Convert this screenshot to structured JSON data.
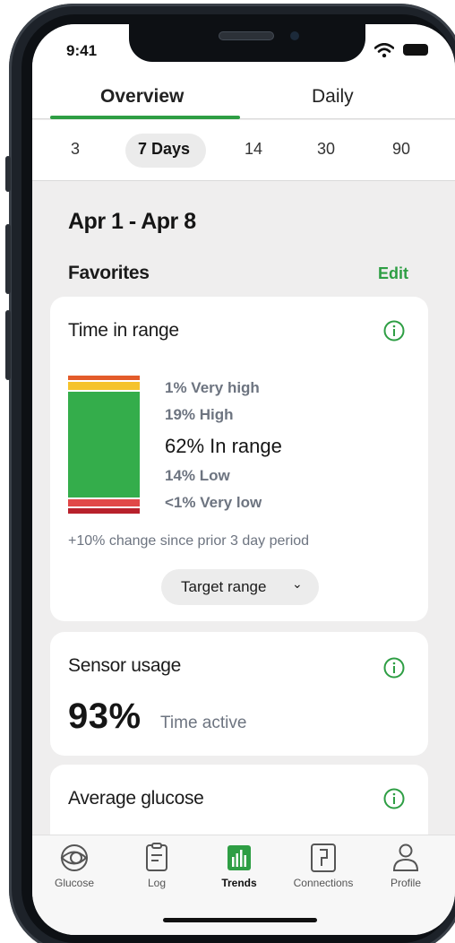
{
  "status_bar": {
    "time": "9:41"
  },
  "top_tabs": [
    {
      "label": "Overview",
      "active": true
    },
    {
      "label": "Daily",
      "active": false
    }
  ],
  "range_options": [
    {
      "label": "3",
      "selected": false
    },
    {
      "label": "7 Days",
      "selected": true
    },
    {
      "label": "14",
      "selected": false
    },
    {
      "label": "30",
      "selected": false
    },
    {
      "label": "90",
      "selected": false
    }
  ],
  "date_range": "Apr 1 - Apr 8",
  "favorites": {
    "title": "Favorites",
    "edit_label": "Edit"
  },
  "time_in_range": {
    "title": "Time in range",
    "very_high": "1% Very high",
    "high": "19% High",
    "in_range": "62% In range",
    "low": "14% Low",
    "very_low": "<1% Very low",
    "change_text": "+10% change since prior 3 day period",
    "target_button": "Target range",
    "colors": {
      "very_high": "#e35b2a",
      "high": "#f5c32c",
      "in_range": "#34ad4b",
      "low": "#e14848",
      "very_low": "#b8212c"
    }
  },
  "sensor_usage": {
    "title": "Sensor usage",
    "value": "93%",
    "unit": "Time active"
  },
  "average_glucose": {
    "title": "Average glucose"
  },
  "bottom_nav": [
    {
      "label": "Glucose",
      "icon": "sensor-icon",
      "active": false
    },
    {
      "label": "Log",
      "icon": "clipboard-icon",
      "active": false
    },
    {
      "label": "Trends",
      "icon": "bar-chart-icon",
      "active": true
    },
    {
      "label": "Connections",
      "icon": "connections-icon",
      "active": false
    },
    {
      "label": "Profile",
      "icon": "person-icon",
      "active": false
    }
  ],
  "accent_color": "#2e9e44"
}
